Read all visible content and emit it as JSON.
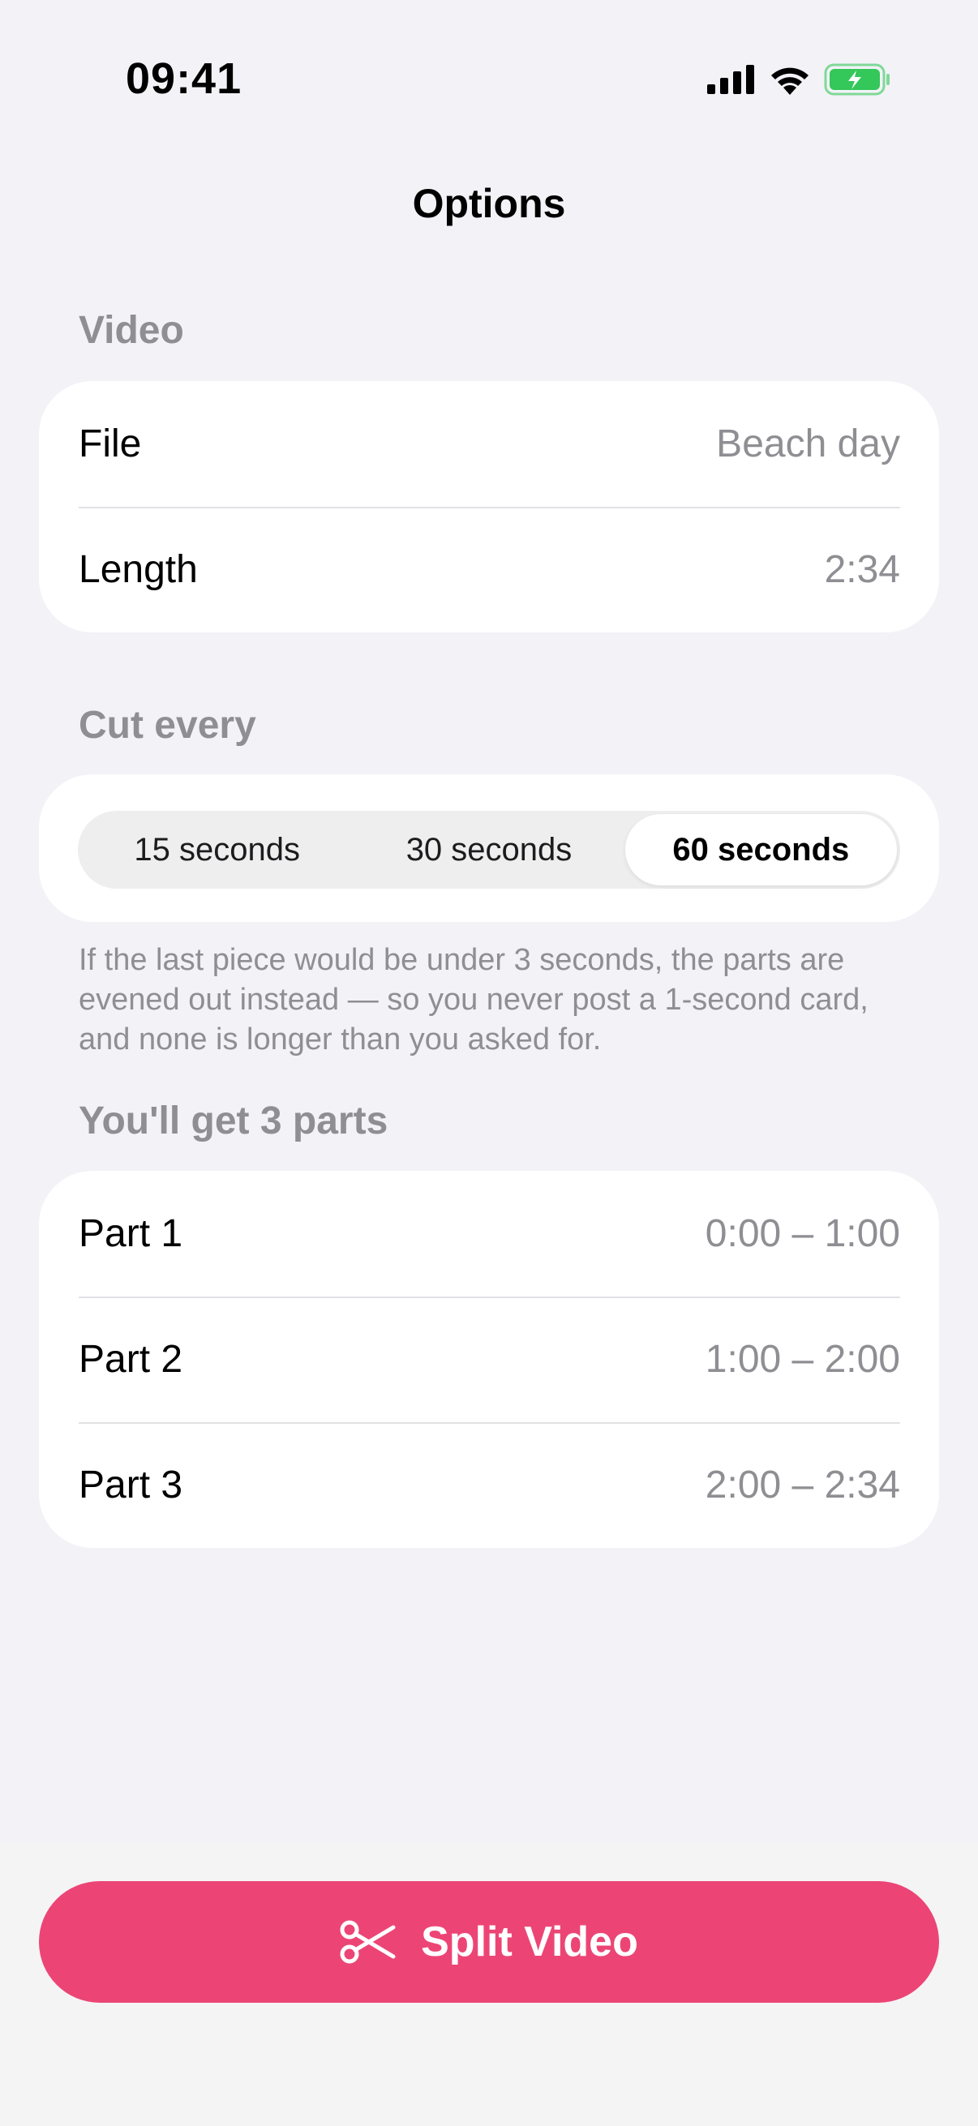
{
  "status_bar": {
    "time": "09:41",
    "icons": [
      "cellular-signal-icon",
      "wifi-icon",
      "battery-charging-icon"
    ],
    "battery_color": "#34c759"
  },
  "nav": {
    "title": "Options"
  },
  "video_section": {
    "header": "Video",
    "rows": [
      {
        "label": "File",
        "value": "Beach day"
      },
      {
        "label": "Length",
        "value": "2:34"
      }
    ]
  },
  "cut_section": {
    "header": "Cut every",
    "options": [
      "15 seconds",
      "30 seconds",
      "60 seconds"
    ],
    "selected": "60 seconds",
    "footnote": "If the last piece would be under 3 seconds, the parts are evened out instead — so you never post a 1-second card, and none is longer than you asked for."
  },
  "parts_section": {
    "header": "You'll get 3 parts",
    "rows": [
      {
        "label": "Part 1",
        "value": "0:00 – 1:00"
      },
      {
        "label": "Part 2",
        "value": "1:00 – 2:00"
      },
      {
        "label": "Part 3",
        "value": "2:00 – 2:34"
      }
    ]
  },
  "action": {
    "label": "Split Video",
    "icon": "scissors-icon",
    "color": "#ec4575"
  }
}
